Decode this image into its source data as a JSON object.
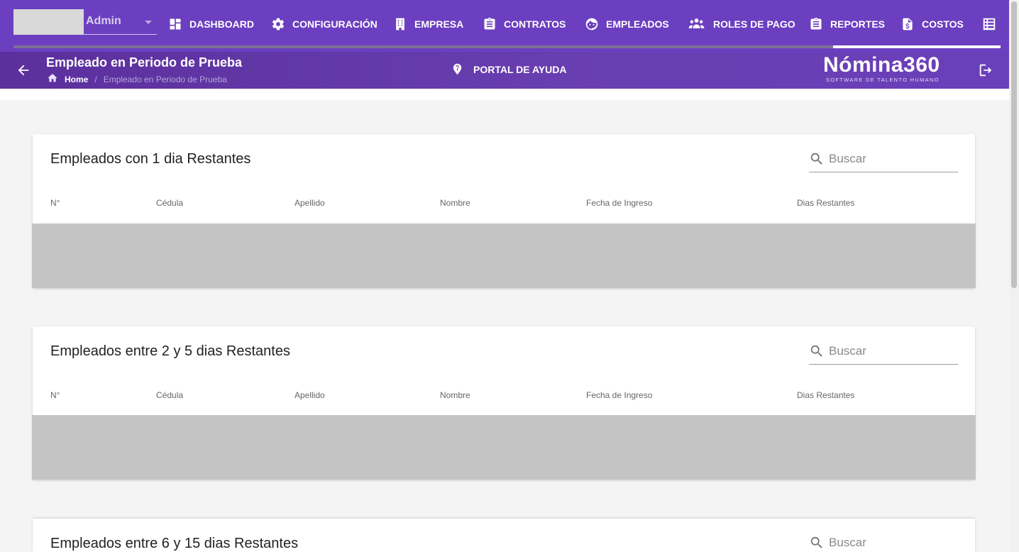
{
  "colors": {
    "nav_bg": "#6b3fc0",
    "subheader_bg": "#6a3fb2",
    "empty_table": "#c4c4c4"
  },
  "user": {
    "name": "Admin"
  },
  "nav": {
    "progress_fraction": 0.17,
    "items": [
      {
        "label": "DASHBOARD",
        "icon": "dashboard-icon"
      },
      {
        "label": "CONFIGURACIÓN",
        "icon": "gear-icon"
      },
      {
        "label": "EMPRESA",
        "icon": "building-icon"
      },
      {
        "label": "CONTRATOS",
        "icon": "clipboard-icon"
      },
      {
        "label": "EMPLEADOS",
        "icon": "face-icon"
      },
      {
        "label": "ROLES DE PAGO",
        "icon": "group-icon"
      },
      {
        "label": "REPORTES",
        "icon": "clipboard-icon"
      },
      {
        "label": "COSTOS",
        "icon": "invoice-dollar-icon"
      }
    ],
    "more_icon": "list-icon"
  },
  "header": {
    "title": "Empleado en Periodo de Prueba",
    "breadcrumb": {
      "home": "Home",
      "separator": "/",
      "current": "Empleado en Periodo de Prueba"
    },
    "help": "PORTAL DE AYUDA",
    "logo": {
      "main": "Nómina360",
      "tagline": "SOFTWARE DE TALENTO HUMANO"
    }
  },
  "columns": [
    "N°",
    "Cédula",
    "Apellido",
    "Nombre",
    "Fecha de Ingreso",
    "Dias Restantes"
  ],
  "tables": [
    {
      "title": "Empleados con 1 dia Restantes",
      "search_placeholder": "Buscar",
      "rows": []
    },
    {
      "title": "Empleados entre 2 y 5 dias Restantes",
      "search_placeholder": "Buscar",
      "rows": []
    },
    {
      "title": "Empleados entre 6 y 15 dias Restantes",
      "search_placeholder": "Buscar",
      "rows": []
    }
  ]
}
